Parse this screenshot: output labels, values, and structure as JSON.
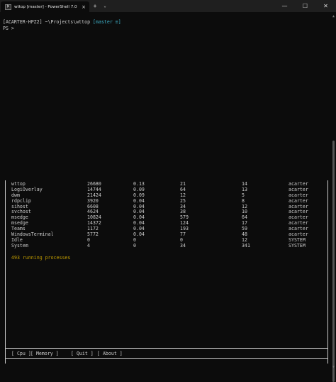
{
  "window": {
    "tab_title": "wttop [master] - PowerShell 7.0",
    "tab_close": "×",
    "new_tab": "+",
    "dropdown": "⌄",
    "minimize": "—",
    "maximize": "☐",
    "close": "✕"
  },
  "prompt": {
    "line1_prefix": "[ACARTER-HPZ2] ~\\Projects\\wttop ",
    "branch": "[master ≡]",
    "line2": "PS >"
  },
  "processes": [
    [
      "wttop",
      "26680",
      "0.13",
      "21",
      "14",
      "acarter"
    ],
    [
      "LogiOverlay",
      "14744",
      "0.09",
      "64",
      "13",
      "acarter"
    ],
    [
      "dwm",
      "21424",
      "0.09",
      "12",
      "5",
      "acarter"
    ],
    [
      "rdpclip",
      "3920",
      "0.04",
      "25",
      "8",
      "acarter"
    ],
    [
      "sihost",
      "6608",
      "0.04",
      "34",
      "12",
      "acarter"
    ],
    [
      "svchost",
      "4624",
      "0.04",
      "38",
      "10",
      "acarter"
    ],
    [
      "msedge",
      "10824",
      "0.04",
      "579",
      "64",
      "acarter"
    ],
    [
      "msedge",
      "14372",
      "0.04",
      "124",
      "17",
      "acarter"
    ],
    [
      "Teams",
      "1172",
      "0.04",
      "193",
      "59",
      "acarter"
    ],
    [
      "WindowsTerminal",
      "5772",
      "0.04",
      "77",
      "48",
      "acarter"
    ],
    [
      "Idle",
      "0",
      "0",
      "0",
      "12",
      "SYSTEM"
    ],
    [
      "System",
      "4",
      "0",
      "34",
      "341",
      "SYSTEM"
    ]
  ],
  "status_text": "493 running processes",
  "footer": {
    "cpu": "[ Cpu ]",
    "memory": "[ Memory ]",
    "quit": "[ Quit ]",
    "about": "[ About ]"
  },
  "colors": {
    "background": "#0c0c0c",
    "text": "#cccccc",
    "branch": "#3fb0c8",
    "status": "#c19c00"
  }
}
